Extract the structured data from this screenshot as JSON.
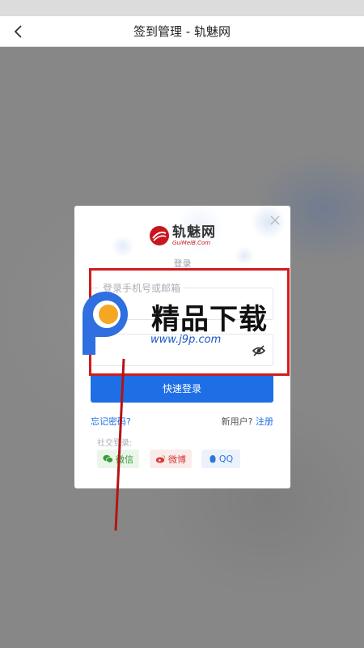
{
  "nav": {
    "title": "签到管理 - 轨魅网"
  },
  "logo": {
    "text": "轨魅网",
    "sub": "GuiMeiB.Com"
  },
  "login": {
    "title": "登录",
    "username_placeholder": "登录手机号或邮箱",
    "password_placeholder": "",
    "submit_label": "快速登录",
    "forgot_label": "忘记密码?",
    "new_user_label": "新用户?",
    "register_label": "注册",
    "social_title": "社交登录:",
    "social": [
      {
        "label": "微信",
        "icon": "wechat-icon",
        "color": "#3a9a3a"
      },
      {
        "label": "微博",
        "icon": "weibo-icon",
        "color": "#d83a3a"
      },
      {
        "label": "QQ",
        "icon": "qq-icon",
        "color": "#2a75e0"
      }
    ]
  },
  "watermark": {
    "title": "精品下载",
    "url": "www.j9p.com"
  },
  "colors": {
    "primary": "#1e6fe6",
    "annotation": "#d11c1c",
    "brand_red": "#c8161d"
  }
}
